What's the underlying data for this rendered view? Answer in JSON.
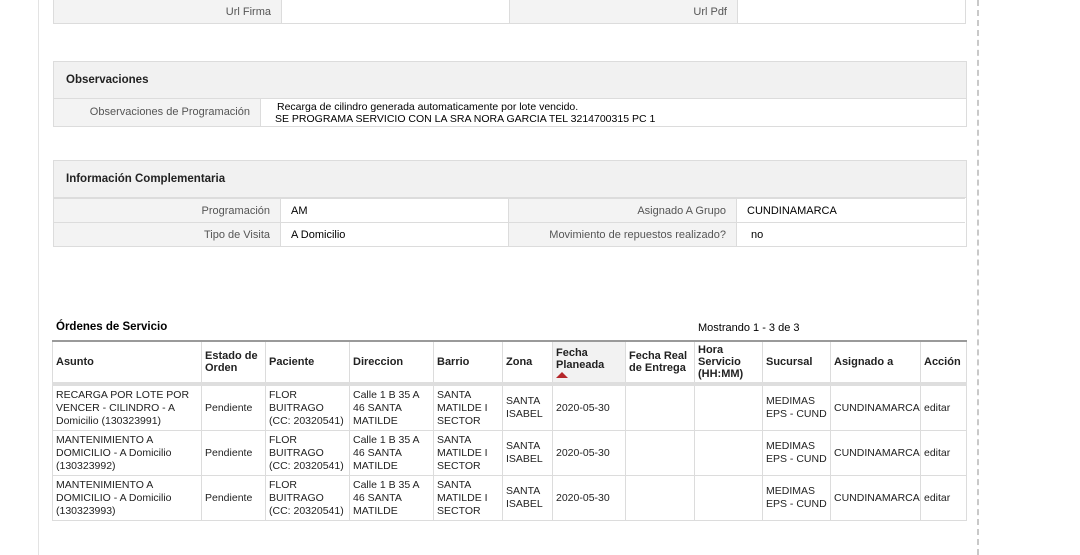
{
  "top_row": {
    "url_firma_label": "Url Firma",
    "url_firma_value": "",
    "url_pdf_label": "Url Pdf",
    "url_pdf_value": ""
  },
  "observaciones": {
    "title": "Observaciones",
    "label": "Observaciones de Programación",
    "line1": "Recarga de cilindro generada automaticamente por lote vencido.",
    "line2": "SE PROGRAMA SERVICIO CON LA SRA NORA GARCIA TEL 3214700315 PC 1"
  },
  "info_complementaria": {
    "title": "Información Complementaria",
    "programacion_label": "Programación",
    "programacion_value": "AM",
    "asignado_label": "Asignado A Grupo",
    "asignado_value": "CUNDINAMARCA",
    "tipo_visita_label": "Tipo de Visita",
    "tipo_visita_value": "A Domicilio",
    "movimiento_label": "Movimiento de repuestos realizado?",
    "movimiento_value": "no"
  },
  "orders": {
    "title": "Órdenes de Servicio",
    "count_text": "Mostrando 1 - 3 de 3",
    "headers": {
      "asunto": "Asunto",
      "estado": "Estado de Orden",
      "paciente": "Paciente",
      "direccion": "Direccion",
      "barrio": "Barrio",
      "zona": "Zona",
      "fecha_planeada": "Fecha Planeada",
      "fecha_real": "Fecha Real de Entrega",
      "hora": "Hora Servicio (HH:MM)",
      "sucursal": "Sucursal",
      "asignado": "Asignado a",
      "accion": "Acción"
    },
    "rows": [
      {
        "asunto": "RECARGA POR LOTE POR VENCER - CILINDRO - A Domicilio (130323991)",
        "estado": "Pendiente",
        "paciente": "FLOR BUITRAGO (CC: 20320541)",
        "direccion": "Calle 1 B 35 A 46 SANTA MATILDE",
        "barrio": "SANTA MATILDE I SECTOR",
        "zona": "SANTA ISABEL",
        "fecha_planeada": "2020-05-30",
        "fecha_real": "",
        "hora": "",
        "sucursal": "MEDIMAS EPS - CUND",
        "asignado": "CUNDINAMARCA",
        "accion": "editar"
      },
      {
        "asunto": "MANTENIMIENTO A DOMICILIO - A Domicilio (130323992)",
        "estado": "Pendiente",
        "paciente": "FLOR BUITRAGO (CC: 20320541)",
        "direccion": "Calle 1 B 35 A 46 SANTA MATILDE",
        "barrio": "SANTA MATILDE I SECTOR",
        "zona": "SANTA ISABEL",
        "fecha_planeada": "2020-05-30",
        "fecha_real": "",
        "hora": "",
        "sucursal": "MEDIMAS EPS - CUND",
        "asignado": "CUNDINAMARCA",
        "accion": "editar"
      },
      {
        "asunto": "MANTENIMIENTO A DOMICILIO - A Domicilio (130323993)",
        "estado": "Pendiente",
        "paciente": "FLOR BUITRAGO (CC: 20320541)",
        "direccion": "Calle 1 B 35 A 46 SANTA MATILDE",
        "barrio": "SANTA MATILDE I SECTOR",
        "zona": "SANTA ISABEL",
        "fecha_planeada": "2020-05-30",
        "fecha_real": "",
        "hora": "",
        "sucursal": "MEDIMAS EPS - CUND",
        "asignado": "CUNDINAMARCA",
        "accion": "editar"
      }
    ]
  }
}
